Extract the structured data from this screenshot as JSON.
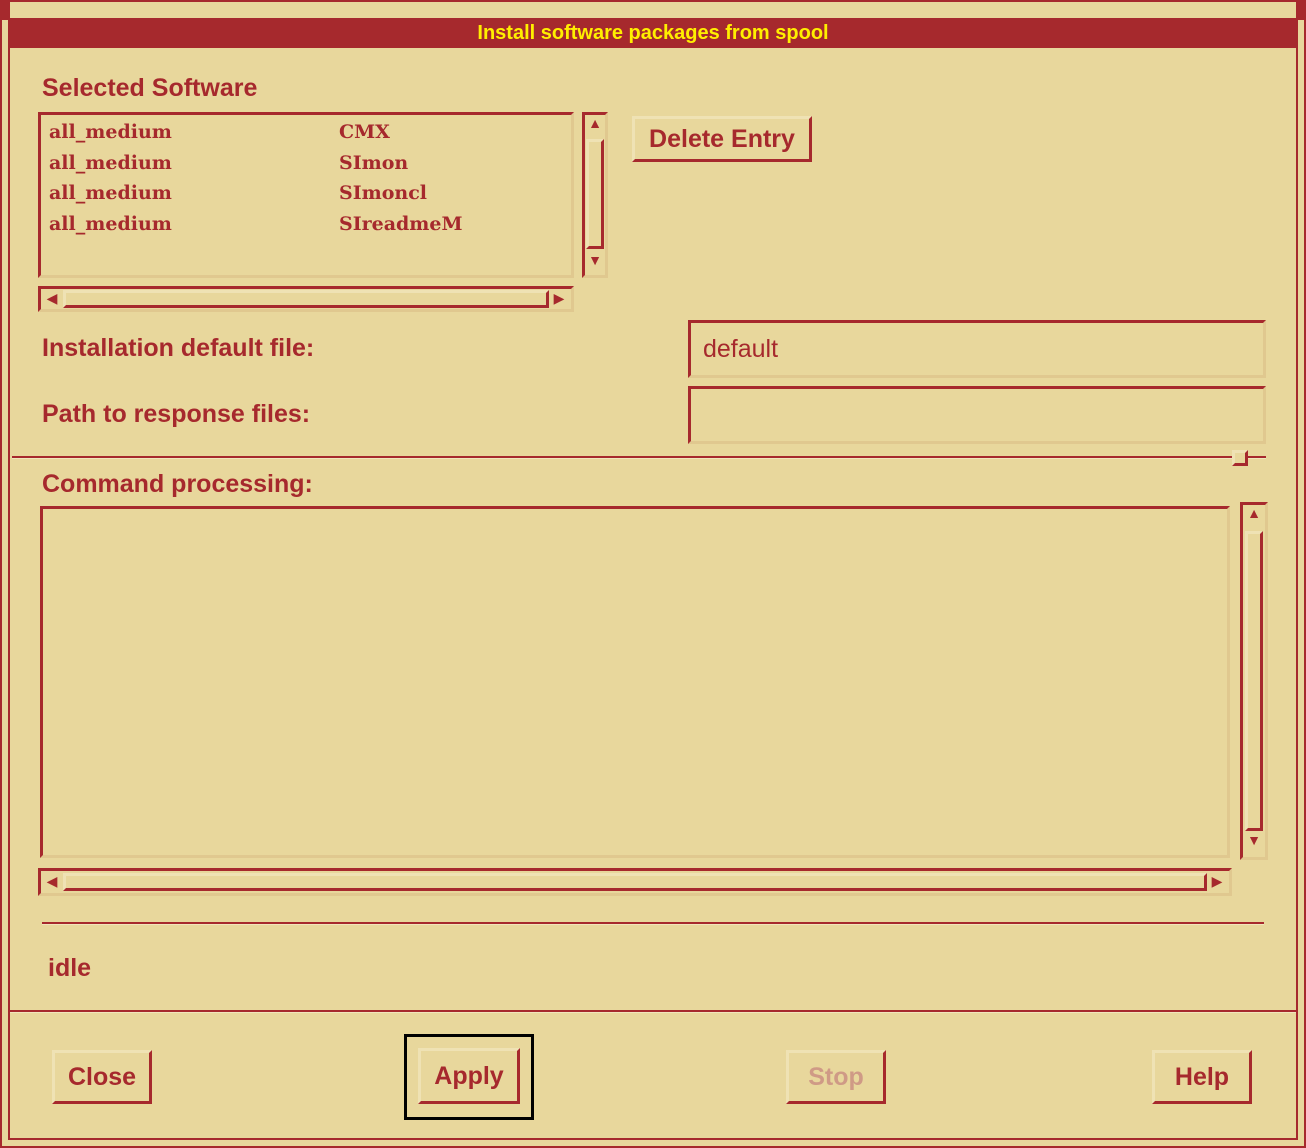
{
  "window": {
    "title": "Install software packages from spool"
  },
  "selected_software": {
    "label": "Selected Software",
    "rows": [
      {
        "set": "all_medium",
        "package": "CMX"
      },
      {
        "set": "all_medium",
        "package": "SImon"
      },
      {
        "set": "all_medium",
        "package": "SImoncl"
      },
      {
        "set": "all_medium",
        "package": "SIreadmeM"
      }
    ]
  },
  "delete_entry": {
    "label": "Delete Entry"
  },
  "installation_default": {
    "label": "Installation default file:",
    "value": "default"
  },
  "response_path": {
    "label": "Path to response files:",
    "value": ""
  },
  "command_processing": {
    "label": "Command processing:",
    "output": ""
  },
  "status": {
    "text": "idle"
  },
  "buttons": {
    "close": "Close",
    "apply": "Apply",
    "stop": "Stop",
    "help": "Help"
  },
  "colors": {
    "accent": "#a6292d",
    "background": "#e8d79c",
    "title_text": "#ffef00",
    "disabled_text": "#cf9a86"
  }
}
